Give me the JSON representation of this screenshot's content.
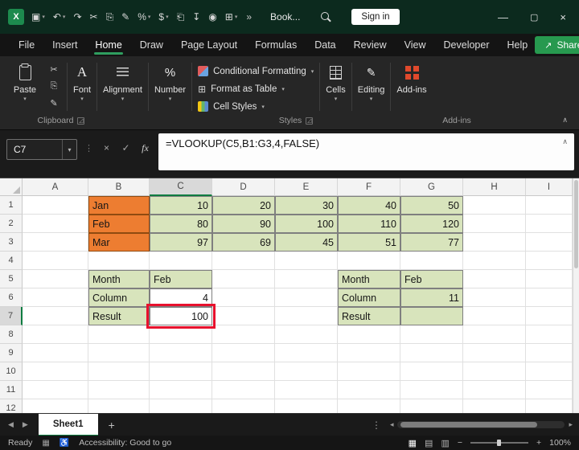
{
  "colors": {
    "title_bg": "#0c2a1e",
    "accent_green": "#2f9e5f",
    "header_select_green": "#107c41",
    "orange_fill": "#ed7d31",
    "green_fill": "#d8e4bc",
    "annotation_red": "#e8112d"
  },
  "icons": {
    "chevron_down": "▾",
    "overflow": "»",
    "minimize": "—",
    "maximize": "▢",
    "close": "×",
    "name_box_chevron": "▾",
    "cancel": "×",
    "enter": "✓",
    "fx": "fx",
    "formula_expand": "∧",
    "ribbon_collapse": "∧",
    "dialog_launcher": "◿",
    "format_as_table": "⊞",
    "editing_pencil": "✎",
    "sheet_prev": "◀",
    "sheet_next": "▶",
    "add_sheet": "+",
    "tab_menu": "⋮",
    "scroll_left": "◂",
    "scroll_right": "▸",
    "record_macro": "▦",
    "accessibility": "♿",
    "normal_view": "▦",
    "page_layout_view": "▤",
    "page_break_view": "▥",
    "zoom_out": "−",
    "zoom_in": "+",
    "share_arrow": "↗"
  },
  "titlebar": {
    "excel_logo_letter": "X",
    "workbook_title": "Book...",
    "sign_in_label": "Sign in",
    "qat": [
      {
        "name": "save-icon",
        "glyph": "▣",
        "chevron": true
      },
      {
        "name": "undo-icon",
        "glyph": "↶",
        "chevron": true
      },
      {
        "name": "redo-icon",
        "glyph": "↷",
        "chevron": false
      },
      {
        "name": "cut-icon",
        "glyph": "✂",
        "chevron": false
      },
      {
        "name": "copy-icon",
        "glyph": "⎘",
        "chevron": false
      },
      {
        "name": "format-painter-icon",
        "glyph": "✎",
        "chevron": false
      },
      {
        "name": "percent-style-icon",
        "glyph": "%",
        "chevron": true
      },
      {
        "name": "currency-style-icon",
        "glyph": "$",
        "chevron": true
      },
      {
        "name": "new-workbook-icon",
        "glyph": "⎗",
        "chevron": false
      },
      {
        "name": "export-icon",
        "glyph": "↧",
        "chevron": false
      },
      {
        "name": "camera-icon",
        "glyph": "◉",
        "chevron": false
      },
      {
        "name": "table-icon",
        "glyph": "⊞",
        "chevron": true
      }
    ]
  },
  "menubar": {
    "items": [
      "File",
      "Insert",
      "Home",
      "Draw",
      "Page Layout",
      "Formulas",
      "Data",
      "Review",
      "View",
      "Developer",
      "Help"
    ],
    "active": "Home",
    "share_label": "Share"
  },
  "ribbon": {
    "paste_label": "Paste",
    "small_buttons": [
      {
        "name": "cut-button",
        "glyph": "✂"
      },
      {
        "name": "copy-button",
        "glyph": "⎘"
      },
      {
        "name": "format-painter-button",
        "glyph": "✎"
      }
    ],
    "font_label": "Font",
    "alignment_label": "Alignment",
    "number_label": "Number",
    "styles": [
      "Conditional Formatting",
      "Format as Table",
      "Cell Styles"
    ],
    "cells_label": "Cells",
    "editing_label": "Editing",
    "addins_label": "Add-ins",
    "group_clipboard": "Clipboard",
    "group_styles": "Styles",
    "group_addins": "Add-ins"
  },
  "formula_bar": {
    "name_box": "C7",
    "formula": "=VLOOKUP(C5,B1:G3,4,FALSE)"
  },
  "grid": {
    "columns": [
      "A",
      "B",
      "C",
      "D",
      "E",
      "F",
      "G",
      "H",
      "I"
    ],
    "rows": [
      "1",
      "2",
      "3",
      "4",
      "5",
      "6",
      "7",
      "8",
      "9",
      "10",
      "11",
      "12"
    ],
    "selected_column": "C",
    "selected_row": "7",
    "selected_cell": "C7",
    "cells": [
      {
        "ref": "B1",
        "v": "Jan",
        "fill": "orange",
        "align": "left"
      },
      {
        "ref": "C1",
        "v": "10",
        "fill": "green",
        "align": "right"
      },
      {
        "ref": "D1",
        "v": "20",
        "fill": "green",
        "align": "right"
      },
      {
        "ref": "E1",
        "v": "30",
        "fill": "green",
        "align": "right"
      },
      {
        "ref": "F1",
        "v": "40",
        "fill": "green",
        "align": "right"
      },
      {
        "ref": "G1",
        "v": "50",
        "fill": "green",
        "align": "right"
      },
      {
        "ref": "B2",
        "v": "Feb",
        "fill": "orange",
        "align": "left"
      },
      {
        "ref": "C2",
        "v": "80",
        "fill": "green",
        "align": "right"
      },
      {
        "ref": "D2",
        "v": "90",
        "fill": "green",
        "align": "right"
      },
      {
        "ref": "E2",
        "v": "100",
        "fill": "green",
        "align": "right"
      },
      {
        "ref": "F2",
        "v": "110",
        "fill": "green",
        "align": "right"
      },
      {
        "ref": "G2",
        "v": "120",
        "fill": "green",
        "align": "right"
      },
      {
        "ref": "B3",
        "v": "Mar",
        "fill": "orange",
        "align": "left"
      },
      {
        "ref": "C3",
        "v": "97",
        "fill": "green",
        "align": "right"
      },
      {
        "ref": "D3",
        "v": "69",
        "fill": "green",
        "align": "right"
      },
      {
        "ref": "E3",
        "v": "45",
        "fill": "green",
        "align": "right"
      },
      {
        "ref": "F3",
        "v": "51",
        "fill": "green",
        "align": "right"
      },
      {
        "ref": "G3",
        "v": "77",
        "fill": "green",
        "align": "right"
      },
      {
        "ref": "B5",
        "v": "Month",
        "fill": "green",
        "align": "left"
      },
      {
        "ref": "C5",
        "v": "Feb",
        "fill": "green",
        "align": "left"
      },
      {
        "ref": "B6",
        "v": "Column",
        "fill": "green",
        "align": "left"
      },
      {
        "ref": "C6",
        "v": "4",
        "fill": "white",
        "align": "right"
      },
      {
        "ref": "B7",
        "v": "Result",
        "fill": "green",
        "align": "left"
      },
      {
        "ref": "C7",
        "v": "100",
        "fill": "white",
        "align": "right"
      },
      {
        "ref": "F5",
        "v": "Month",
        "fill": "green",
        "align": "left"
      },
      {
        "ref": "G5",
        "v": "Feb",
        "fill": "green",
        "align": "left"
      },
      {
        "ref": "F6",
        "v": "Column",
        "fill": "green",
        "align": "left"
      },
      {
        "ref": "G6",
        "v": "11",
        "fill": "green",
        "align": "right"
      },
      {
        "ref": "F7",
        "v": "Result",
        "fill": "green",
        "align": "left"
      },
      {
        "ref": "G7",
        "v": "",
        "fill": "green",
        "align": "left"
      }
    ]
  },
  "sheet_tabs": {
    "active_tab": "Sheet1"
  },
  "status_bar": {
    "mode": "Ready",
    "accessibility": "Accessibility: Good to go",
    "zoom_level": "100%"
  }
}
